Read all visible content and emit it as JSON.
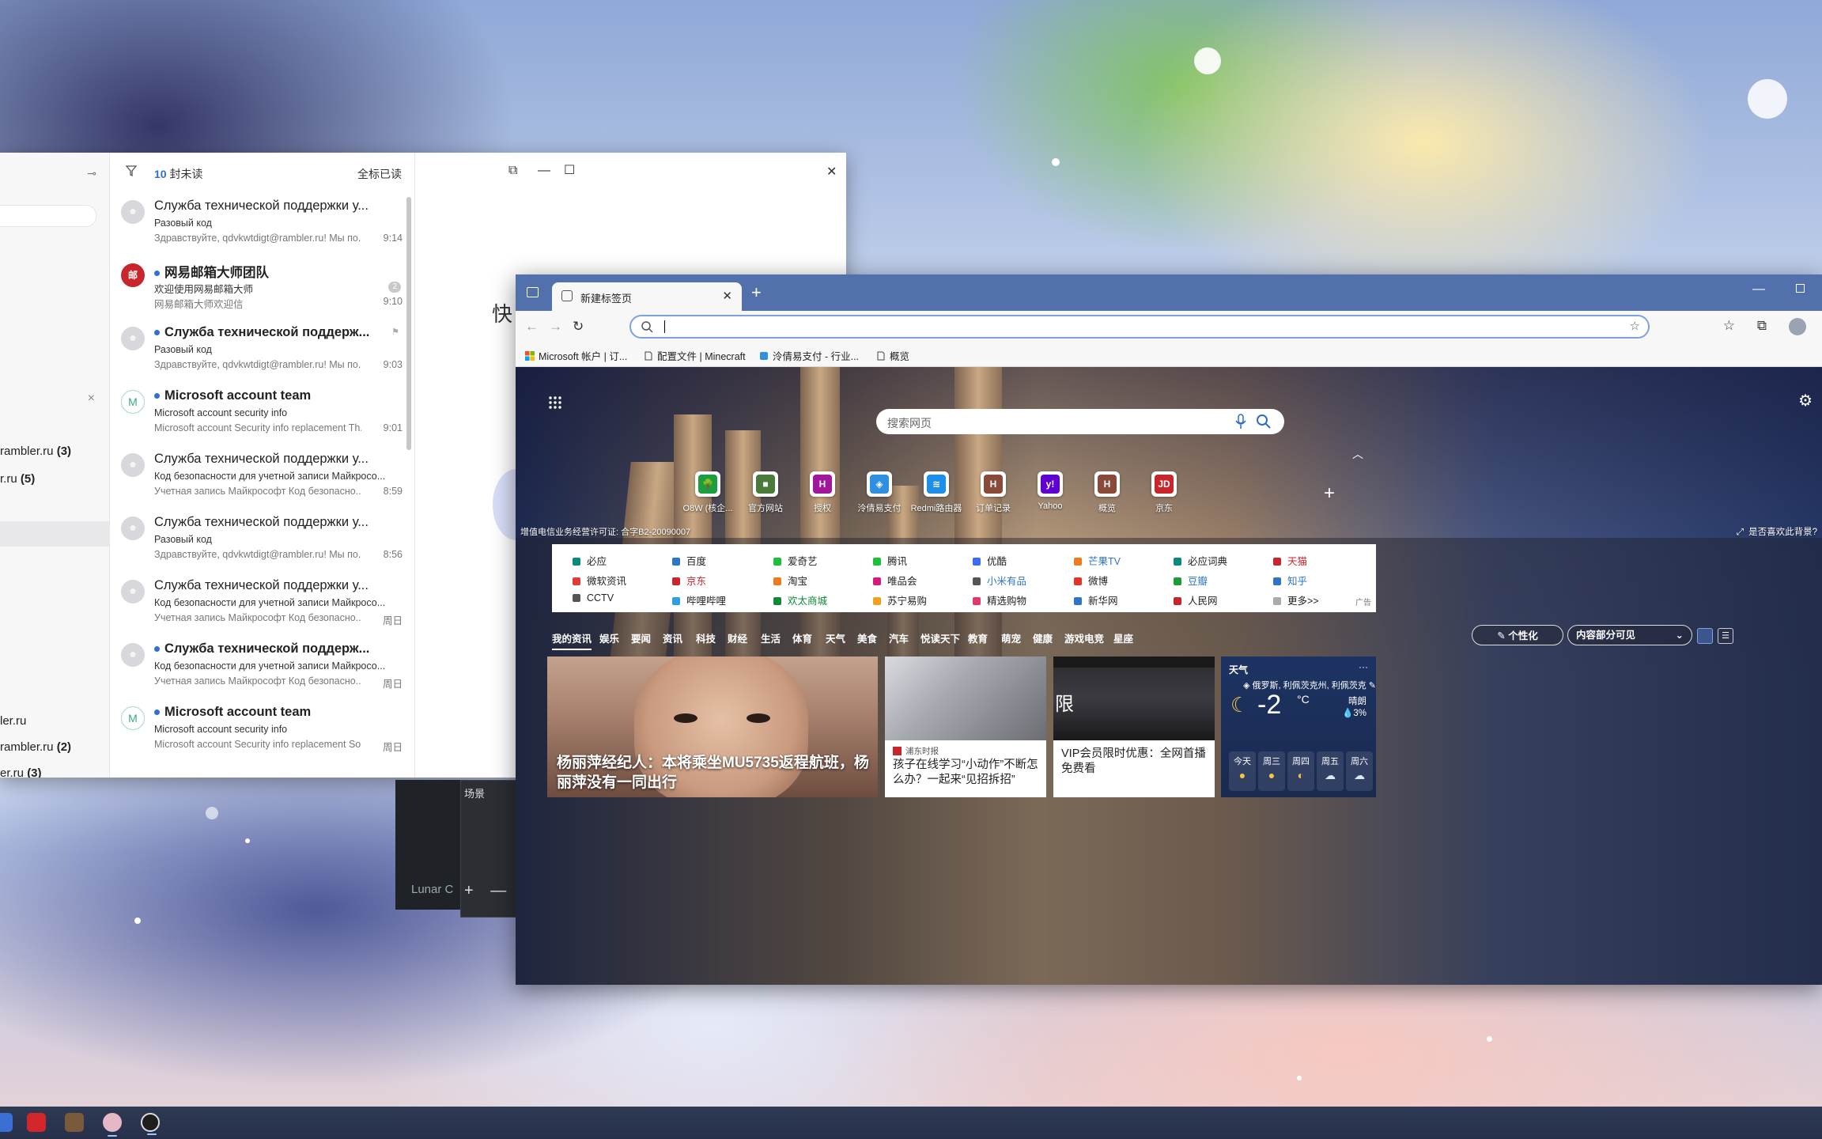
{
  "colors": {
    "edge_tab_strip": "#5270ab",
    "unread_blue": "#2f6fd6",
    "link_red": "#c9262b",
    "link_blue": "#2e74c7",
    "link_green": "#0d8a3a"
  },
  "mail": {
    "accounts": [
      {
        "name": "rambler.ru",
        "count": "(3)"
      },
      {
        "name": "r.ru",
        "count": "(5)"
      },
      {
        "name": "ler.ru",
        "count": ""
      },
      {
        "name": "rambler.ru",
        "count": "(2)"
      },
      {
        "name": "er.ru",
        "count": "(3)"
      }
    ],
    "unread_count": "10",
    "unread_label": "封未读",
    "mark_all_read": "全标已读",
    "messages": [
      {
        "from": "Служба технической поддержки у...",
        "subject": "Разовый код",
        "preview": "Здравствуйте, qdvkwtdigt@rambler.ru! Мы по...",
        "time": "9:14",
        "unread": false,
        "avatar": ""
      },
      {
        "from": "网易邮箱大师团队",
        "subject": "欢迎使用网易邮箱大师",
        "preview": "网易邮箱大师欢迎信",
        "time": "9:10",
        "unread": true,
        "avatar": "邮",
        "badge": "2"
      },
      {
        "from": "Служба технической поддерж...",
        "subject": "Разовый код",
        "preview": "Здравствуйте, qdvkwtdigt@rambler.ru! Мы по...",
        "time": "9:03",
        "unread": true,
        "avatar": ""
      },
      {
        "from": "Microsoft account team",
        "subject": "Microsoft account security info",
        "preview": "Microsoft account Security info replacement Th...",
        "time": "9:01",
        "unread": true,
        "avatar": "M"
      },
      {
        "from": "Служба технической поддержки у...",
        "subject": "Код безопасности для учетной записи Майкросо...",
        "preview": "Учетная запись Майкрософт Код безопасно...",
        "time": "8:59",
        "unread": false,
        "avatar": ""
      },
      {
        "from": "Служба технической поддержки у...",
        "subject": "Разовый код",
        "preview": "Здравствуйте, qdvkwtdigt@rambler.ru! Мы по...",
        "time": "8:56",
        "unread": false,
        "avatar": ""
      },
      {
        "from": "Служба технической поддержки у...",
        "subject": "Код безопасности для учетной записи Майкросо...",
        "preview": "Учетная запись Майкрософт Код безопасно...",
        "time": "周日",
        "unread": false,
        "avatar": ""
      },
      {
        "from": "Служба технической поддерж...",
        "subject": "Код безопасности для учетной записи Майкросо...",
        "preview": "Учетная запись Майкрософт Код безопасно...",
        "time": "周日",
        "unread": true,
        "avatar": ""
      },
      {
        "from": "Microsoft account team",
        "subject": "Microsoft account security info",
        "preview": "Microsoft account Security info replacement So...",
        "time": "周日",
        "unread": true,
        "avatar": "M"
      }
    ],
    "reading_pane_text": "快"
  },
  "scene": {
    "label": "场景",
    "preview_text": "Lunar C",
    "controls": "+ — "
  },
  "browser": {
    "tab_title": "新建标签页",
    "favorites": [
      {
        "label": "Microsoft 帐户 | 订...",
        "icon": "ms-logo-icon"
      },
      {
        "label": "配置文件 | Minecraft",
        "icon": "page-icon"
      },
      {
        "label": "泠倩易支付 - 行业...",
        "icon": "shield-icon"
      },
      {
        "label": "概览",
        "icon": "page-icon"
      }
    ],
    "ntp": {
      "search_placeholder": "搜索网页",
      "quick_links": [
        {
          "label": "O8W (核企...",
          "color": "#1a9e3e",
          "glyph": "🌳"
        },
        {
          "label": "官方网站",
          "color": "#4a7a3a",
          "glyph": "■"
        },
        {
          "label": "授权",
          "color": "#a0179c",
          "glyph": "H"
        },
        {
          "label": "泠倩易支付",
          "color": "#2f8fe0",
          "glyph": "◈"
        },
        {
          "label": "Redmi路由器",
          "color": "#1e8fe6",
          "glyph": "≋"
        },
        {
          "label": "订单记录",
          "color": "#8a4a3a",
          "glyph": "H"
        },
        {
          "label": "Yahoo",
          "color": "#5f01d1",
          "glyph": "y!"
        },
        {
          "label": "概览",
          "color": "#8a4a3a",
          "glyph": "H"
        },
        {
          "label": "京东",
          "color": "#c9262b",
          "glyph": "JD"
        }
      ],
      "icp_text": "增值电信业务经营许可证: 合字B2-20090007",
      "like_bg_text": "是否喜欢此背景?",
      "links": [
        [
          {
            "label": "必应",
            "style": "",
            "icon": "#0a8a7a"
          },
          {
            "label": "百度",
            "style": "",
            "icon": "#2e74c7"
          },
          {
            "label": "爱奇艺",
            "style": "",
            "icon": "#1ec03a"
          },
          {
            "label": "腾讯",
            "style": "",
            "icon": "#1ec03a"
          },
          {
            "label": "优酷",
            "style": "",
            "icon": "#3a6ef0"
          },
          {
            "label": "芒果TV",
            "style": "blue",
            "icon": "#f07a1e"
          },
          {
            "label": "必应词典",
            "style": "",
            "icon": "#0a8a7a"
          },
          {
            "label": "天猫",
            "style": "red",
            "icon": "#c9262b"
          }
        ],
        [
          {
            "label": "微软资讯",
            "style": "",
            "icon": "#e03a3a"
          },
          {
            "label": "京东",
            "style": "red",
            "icon": "#c9262b"
          },
          {
            "label": "淘宝",
            "style": "",
            "icon": "#f07a1e"
          },
          {
            "label": "唯品会",
            "style": "",
            "icon": "#d01e7a"
          },
          {
            "label": "小米有品",
            "style": "blue",
            "icon": "#555"
          },
          {
            "label": "微博",
            "style": "",
            "icon": "#e0352a"
          },
          {
            "label": "豆瓣",
            "style": "blue",
            "icon": "#1e9a3a"
          },
          {
            "label": "知乎",
            "style": "blue",
            "icon": "#2e74c7"
          }
        ],
        [
          {
            "label": "CCTV",
            "style": "",
            "icon": "#555"
          },
          {
            "label": "哔哩哔哩",
            "style": "",
            "icon": "#2ea0e0"
          },
          {
            "label": "欢太商城",
            "style": "green",
            "icon": "#0d8a3a"
          },
          {
            "label": "苏宁易购",
            "style": "",
            "icon": "#f0a21e"
          },
          {
            "label": "精选购物",
            "style": "",
            "icon": "#e03a6a"
          },
          {
            "label": "新华网",
            "style": "",
            "icon": "#2e74c7"
          },
          {
            "label": "人民网",
            "style": "",
            "icon": "#c9262b"
          },
          {
            "label": "更多>>",
            "style": "",
            "icon": "#aaa"
          }
        ]
      ],
      "ad_label": "广告",
      "feed_tabs": [
        "我的资讯",
        "娱乐",
        "要闻",
        "资讯",
        "科技",
        "财经",
        "生活",
        "体育",
        "天气",
        "美食",
        "汽车",
        "悦读天下",
        "教育",
        "萌宠",
        "健康",
        "游戏电竞",
        "星座"
      ],
      "personalize": "个性化",
      "visibility": "内容部分可见",
      "cards": {
        "main_title": "杨丽萍经纪人：本将乘坐MU5735返程航班，杨丽萍没有一同出行",
        "card2_source": "浦东时报",
        "card2_title": "孩子在线学习“小动作”不断怎么办？一起来“见招拆招”",
        "card3_overlay": "限",
        "card3_title": "VIP会员限时优惠：全网首播免费看"
      },
      "weather": {
        "title": "天气",
        "location": "俄罗斯, 利佩茨克州, 利佩茨克",
        "temp": "-2",
        "unit": "°C",
        "condition": "晴朗",
        "rain": "💧3%",
        "days": [
          {
            "label": "今天",
            "icon": "sun-icon"
          },
          {
            "label": "周三",
            "icon": "sun-icon"
          },
          {
            "label": "周四",
            "icon": "partly-cloudy-icon"
          },
          {
            "label": "周五",
            "icon": "cloud-icon"
          },
          {
            "label": "周六",
            "icon": "cloud-icon"
          }
        ]
      }
    }
  },
  "taskbar": {
    "icons": [
      "app-icon",
      "media-icon",
      "minecraft-icon",
      "mail-icon",
      "obs-icon"
    ]
  }
}
